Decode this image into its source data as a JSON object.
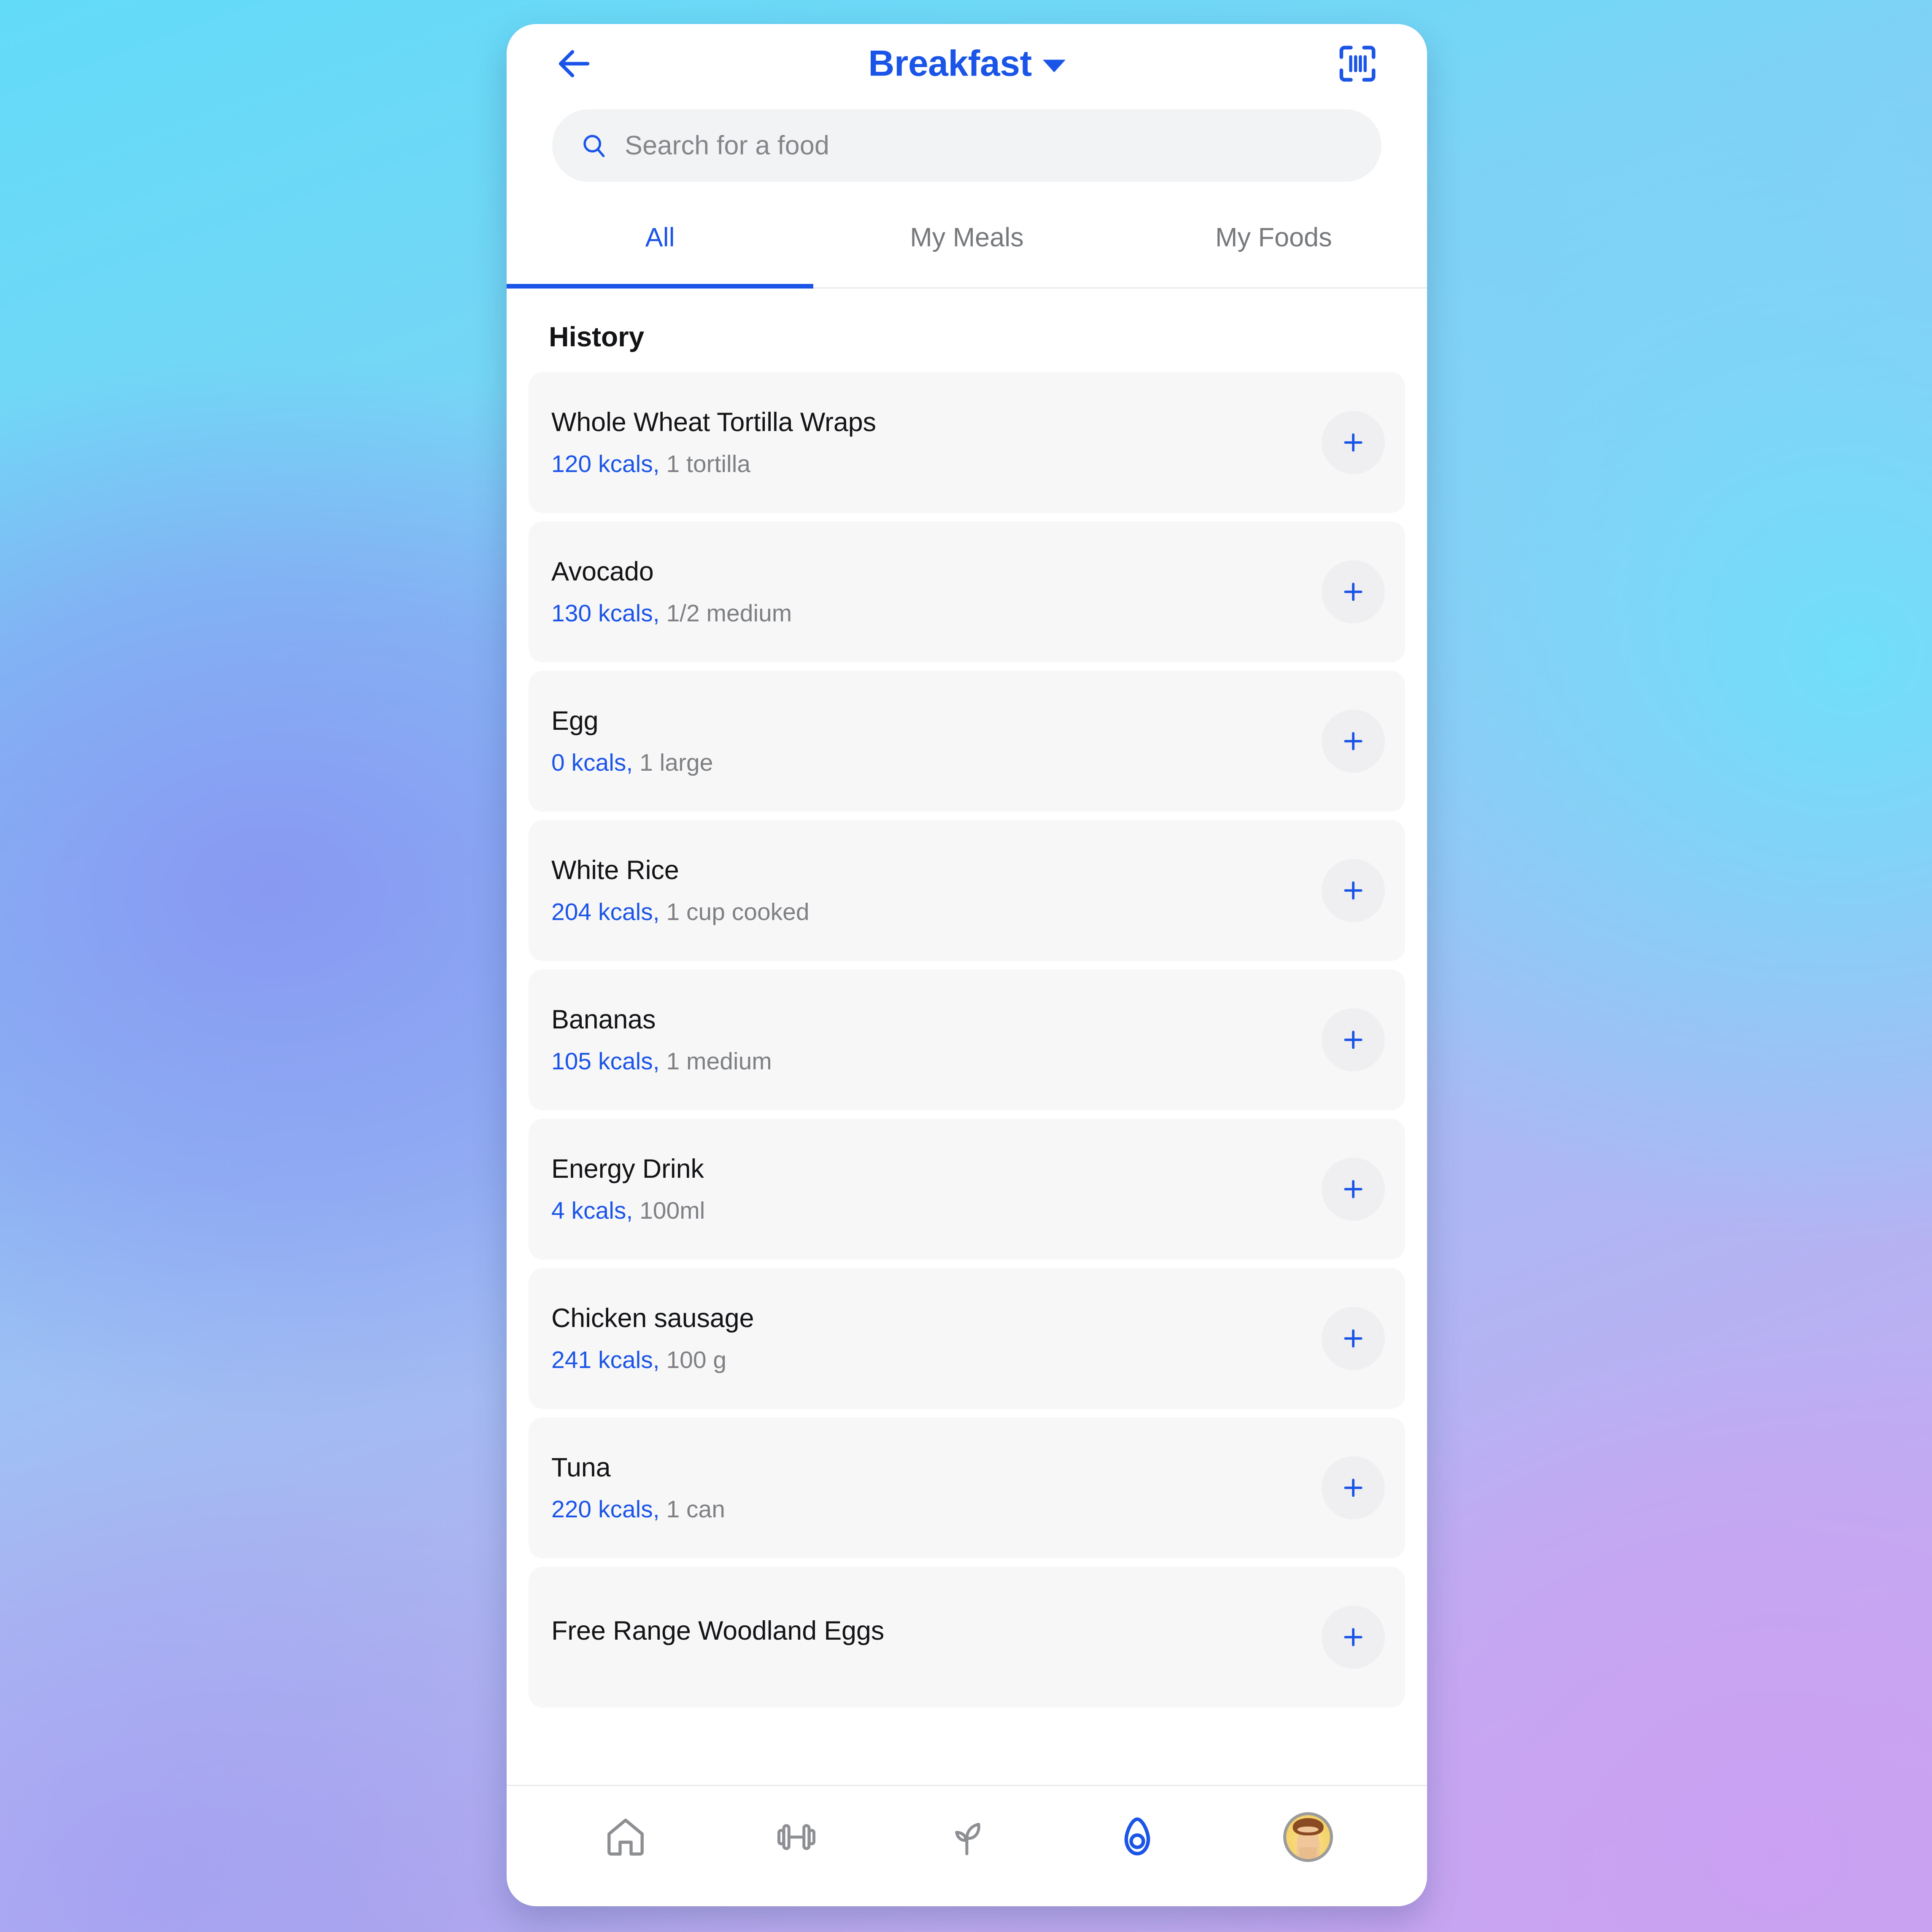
{
  "theme": {
    "accent": "#1B55E8",
    "text_primary": "#131416",
    "text_muted": "#7E8084",
    "row_bg": "#F7F7F8",
    "search_bg": "#F2F3F5",
    "card_bg": "#FFFFFF"
  },
  "header": {
    "back_icon": "arrow-left-icon",
    "title": "Breakfast",
    "dropdown_icon": "chevron-down-icon",
    "scan_icon": "barcode-scan-icon"
  },
  "search": {
    "icon": "search-icon",
    "placeholder": "Search for a food",
    "value": ""
  },
  "tabs": [
    {
      "label": "All",
      "active": true
    },
    {
      "label": "My Meals",
      "active": false
    },
    {
      "label": "My Foods",
      "active": false
    }
  ],
  "list": {
    "section_title": "History",
    "add_icon": "plus-icon",
    "items": [
      {
        "name": "Whole Wheat Tortilla Wraps",
        "calories": "120 kcals,",
        "serving": "1 tortilla"
      },
      {
        "name": "Avocado",
        "calories": "130 kcals,",
        "serving": "1/2 medium"
      },
      {
        "name": "Egg",
        "calories": "0 kcals,",
        "serving": "1 large"
      },
      {
        "name": "White Rice",
        "calories": "204 kcals,",
        "serving": "1 cup cooked"
      },
      {
        "name": "Bananas",
        "calories": "105 kcals,",
        "serving": "1 medium"
      },
      {
        "name": "Energy Drink",
        "calories": "4 kcals,",
        "serving": "100ml"
      },
      {
        "name": "Chicken sausage",
        "calories": "241 kcals,",
        "serving": "100 g"
      },
      {
        "name": "Tuna",
        "calories": "220 kcals,",
        "serving": "1 can"
      },
      {
        "name": "Free Range Woodland Eggs",
        "calories": "",
        "serving": ""
      }
    ]
  },
  "bottom_nav": [
    {
      "icon": "home-icon",
      "active": false
    },
    {
      "icon": "dumbbell-icon",
      "active": false
    },
    {
      "icon": "leaf-sprout-icon",
      "active": false
    },
    {
      "icon": "avocado-icon",
      "active": true
    },
    {
      "icon": "profile-avatar-icon",
      "active": false
    }
  ]
}
